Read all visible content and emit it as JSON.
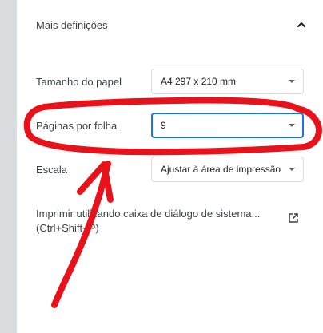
{
  "section": {
    "title": "Mais definições",
    "toggle_icon": "chevron-up-icon"
  },
  "settings": {
    "paper_size": {
      "label": "Tamanho do papel",
      "value": "A4 297 x 210 mm"
    },
    "pages_per_sheet": {
      "label": "Páginas por folha",
      "value": "9"
    },
    "scale": {
      "label": "Escala",
      "value": "Ajustar à área de impressão"
    }
  },
  "system_dialog": {
    "text": "Imprimir utilizando caixa de diálogo de sistema... (Ctrl+Shift+P)",
    "icon": "open-in-new-icon"
  },
  "colors": {
    "accent": "#1a73e8",
    "annotation": "#e8121b",
    "rail": "#dadce0"
  }
}
